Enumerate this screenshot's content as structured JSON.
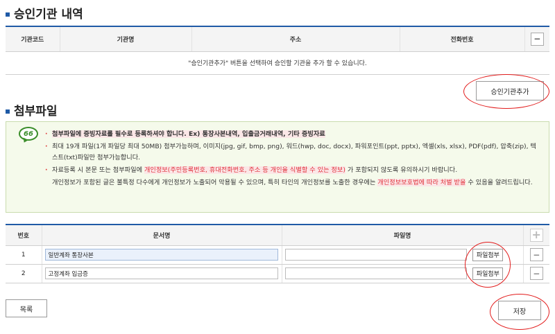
{
  "approval": {
    "title": "승인기관 내역",
    "headers": [
      "기관코드",
      "기관명",
      "주소",
      "전화번호"
    ],
    "remove_icon": "minus-icon",
    "empty_message": "\"승인기관추가\" 버튼을 선택하여 승인할 기관을 추가 할 수 있습니다.",
    "add_button": "승인기관추가"
  },
  "attachments": {
    "title": "첨부파일",
    "notice": {
      "icon": "quote-icon",
      "icon_text": "66",
      "line1": "첨부파일에 증빙자료를 필수로 등록하셔야 합니다. Ex) 통장사본내역, 입출금거래내역, 기타 증빙자료",
      "line2": "최대 19개 파일(1개 파일당 최대 50MB) 첨부가능하며, 이미지(jpg, gif, bmp, png), 워드(hwp, doc, docx), 파워포인트(ppt, pptx), 엑셀(xls, xlsx), PDF(pdf), 압축(zip), 텍스트(txt)파일만 첨부가능합니다.",
      "line3_a": "자료등록 시 본문 또는 첨부파일에",
      "line3_b": "개인정보(주민등록번호, 휴대전화번호, 주소 등 개인을 식별할 수 있는 정보)",
      "line3_c": "가 포함되지 않도록 유의하시기 바랍니다.",
      "line4_a": "개인정보가 포함된 글은 불특정 다수에게 개인정보가 노출되어 악용될 수 있으며, 특히 타인의 개인정보를 노출한 경우에는",
      "line4_b": "개인정보보호법에 따라 처벌 받을",
      "line4_c": "수 있음을 알려드립니다."
    },
    "headers": [
      "번호",
      "문서명",
      "파일명"
    ],
    "add_icon": "plus-icon",
    "rows": [
      {
        "no": "1",
        "doc_name": "일반계좌 통장사본",
        "attach_label": "파일첨부",
        "remove_icon": "minus-icon"
      },
      {
        "no": "2",
        "doc_name": "고정계좌 입금증",
        "attach_label": "파일첨부",
        "remove_icon": "minus-icon"
      }
    ]
  },
  "footer": {
    "list_button": "목록",
    "save_button": "저장"
  },
  "colors": {
    "accent": "#1f5aa6",
    "warning_text": "#e0313a",
    "notice_bg": "#f5faeb",
    "annotation": "#e21b1b"
  }
}
